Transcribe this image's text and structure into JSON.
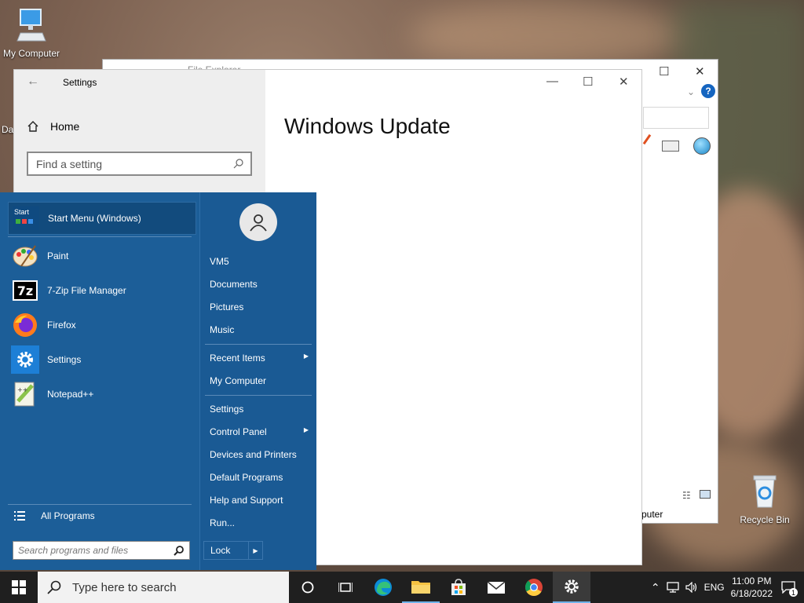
{
  "desktop": {
    "icons": [
      {
        "label": "My Computer"
      },
      {
        "label": "Recycle Bin"
      }
    ],
    "partial_label": "Da"
  },
  "explorer": {
    "title": "File Explorer",
    "status_partial": "puter"
  },
  "settings": {
    "title": "Settings",
    "home_label": "Home",
    "search_placeholder": "Find a setting",
    "heading": "Windows Update"
  },
  "start_menu": {
    "pinned": [
      {
        "label": "Start Menu (Windows)",
        "icon": "start-menu-icon"
      },
      {
        "label": "Paint",
        "icon": "paint-icon"
      },
      {
        "label": "7-Zip File Manager",
        "icon": "7zip-icon"
      },
      {
        "label": "Firefox",
        "icon": "firefox-icon"
      },
      {
        "label": "Settings",
        "icon": "gear-icon"
      },
      {
        "label": "Notepad++",
        "icon": "notepadpp-icon"
      }
    ],
    "all_programs": "All Programs",
    "search_placeholder": "Search programs and files",
    "right_items": [
      {
        "label": "VM5",
        "arrow": false
      },
      {
        "label": "Documents",
        "arrow": false
      },
      {
        "label": "Pictures",
        "arrow": false
      },
      {
        "label": "Music",
        "arrow": false
      },
      {
        "label": "Recent Items",
        "arrow": true
      },
      {
        "label": "My Computer",
        "arrow": false
      },
      {
        "label": "Settings",
        "arrow": false
      },
      {
        "label": "Control Panel",
        "arrow": true
      },
      {
        "label": "Devices and Printers",
        "arrow": false
      },
      {
        "label": "Default Programs",
        "arrow": false
      },
      {
        "label": "Help and Support",
        "arrow": false
      },
      {
        "label": "Run...",
        "arrow": false
      }
    ],
    "lock_label": "Lock",
    "start_icon_text": "Start"
  },
  "taskbar": {
    "search_placeholder": "Type here to search",
    "language": "ENG",
    "time": "11:00 PM",
    "date": "6/18/2022",
    "notification_count": "1"
  },
  "colors": {
    "start_bg": "#1c5e98",
    "taskbar_bg": "#1f1f1f",
    "accent": "#0078d7"
  }
}
